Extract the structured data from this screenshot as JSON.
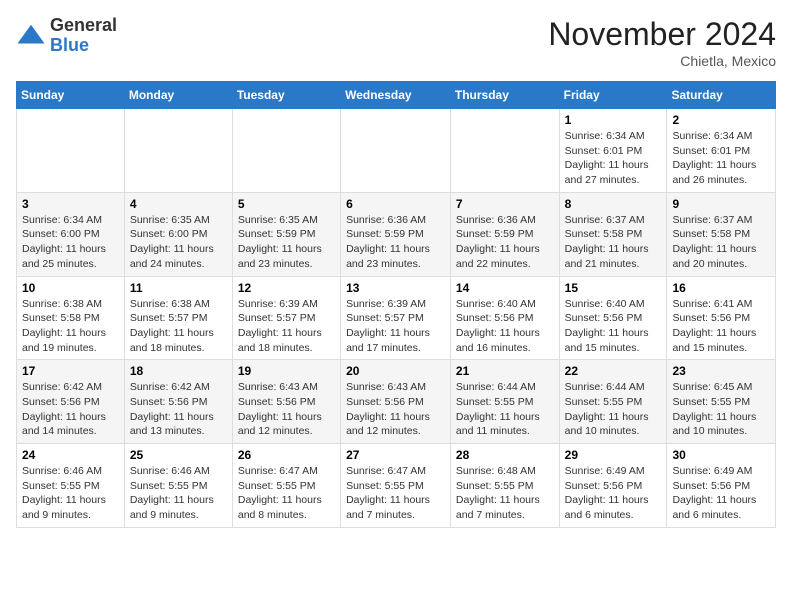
{
  "logo": {
    "general": "General",
    "blue": "Blue"
  },
  "header": {
    "month": "November 2024",
    "location": "Chietla, Mexico"
  },
  "weekdays": [
    "Sunday",
    "Monday",
    "Tuesday",
    "Wednesday",
    "Thursday",
    "Friday",
    "Saturday"
  ],
  "weeks": [
    [
      {
        "day": "",
        "info": ""
      },
      {
        "day": "",
        "info": ""
      },
      {
        "day": "",
        "info": ""
      },
      {
        "day": "",
        "info": ""
      },
      {
        "day": "",
        "info": ""
      },
      {
        "day": "1",
        "info": "Sunrise: 6:34 AM\nSunset: 6:01 PM\nDaylight: 11 hours\nand 27 minutes."
      },
      {
        "day": "2",
        "info": "Sunrise: 6:34 AM\nSunset: 6:01 PM\nDaylight: 11 hours\nand 26 minutes."
      }
    ],
    [
      {
        "day": "3",
        "info": "Sunrise: 6:34 AM\nSunset: 6:00 PM\nDaylight: 11 hours\nand 25 minutes."
      },
      {
        "day": "4",
        "info": "Sunrise: 6:35 AM\nSunset: 6:00 PM\nDaylight: 11 hours\nand 24 minutes."
      },
      {
        "day": "5",
        "info": "Sunrise: 6:35 AM\nSunset: 5:59 PM\nDaylight: 11 hours\nand 23 minutes."
      },
      {
        "day": "6",
        "info": "Sunrise: 6:36 AM\nSunset: 5:59 PM\nDaylight: 11 hours\nand 23 minutes."
      },
      {
        "day": "7",
        "info": "Sunrise: 6:36 AM\nSunset: 5:59 PM\nDaylight: 11 hours\nand 22 minutes."
      },
      {
        "day": "8",
        "info": "Sunrise: 6:37 AM\nSunset: 5:58 PM\nDaylight: 11 hours\nand 21 minutes."
      },
      {
        "day": "9",
        "info": "Sunrise: 6:37 AM\nSunset: 5:58 PM\nDaylight: 11 hours\nand 20 minutes."
      }
    ],
    [
      {
        "day": "10",
        "info": "Sunrise: 6:38 AM\nSunset: 5:58 PM\nDaylight: 11 hours\nand 19 minutes."
      },
      {
        "day": "11",
        "info": "Sunrise: 6:38 AM\nSunset: 5:57 PM\nDaylight: 11 hours\nand 18 minutes."
      },
      {
        "day": "12",
        "info": "Sunrise: 6:39 AM\nSunset: 5:57 PM\nDaylight: 11 hours\nand 18 minutes."
      },
      {
        "day": "13",
        "info": "Sunrise: 6:39 AM\nSunset: 5:57 PM\nDaylight: 11 hours\nand 17 minutes."
      },
      {
        "day": "14",
        "info": "Sunrise: 6:40 AM\nSunset: 5:56 PM\nDaylight: 11 hours\nand 16 minutes."
      },
      {
        "day": "15",
        "info": "Sunrise: 6:40 AM\nSunset: 5:56 PM\nDaylight: 11 hours\nand 15 minutes."
      },
      {
        "day": "16",
        "info": "Sunrise: 6:41 AM\nSunset: 5:56 PM\nDaylight: 11 hours\nand 15 minutes."
      }
    ],
    [
      {
        "day": "17",
        "info": "Sunrise: 6:42 AM\nSunset: 5:56 PM\nDaylight: 11 hours\nand 14 minutes."
      },
      {
        "day": "18",
        "info": "Sunrise: 6:42 AM\nSunset: 5:56 PM\nDaylight: 11 hours\nand 13 minutes."
      },
      {
        "day": "19",
        "info": "Sunrise: 6:43 AM\nSunset: 5:56 PM\nDaylight: 11 hours\nand 12 minutes."
      },
      {
        "day": "20",
        "info": "Sunrise: 6:43 AM\nSunset: 5:56 PM\nDaylight: 11 hours\nand 12 minutes."
      },
      {
        "day": "21",
        "info": "Sunrise: 6:44 AM\nSunset: 5:55 PM\nDaylight: 11 hours\nand 11 minutes."
      },
      {
        "day": "22",
        "info": "Sunrise: 6:44 AM\nSunset: 5:55 PM\nDaylight: 11 hours\nand 10 minutes."
      },
      {
        "day": "23",
        "info": "Sunrise: 6:45 AM\nSunset: 5:55 PM\nDaylight: 11 hours\nand 10 minutes."
      }
    ],
    [
      {
        "day": "24",
        "info": "Sunrise: 6:46 AM\nSunset: 5:55 PM\nDaylight: 11 hours\nand 9 minutes."
      },
      {
        "day": "25",
        "info": "Sunrise: 6:46 AM\nSunset: 5:55 PM\nDaylight: 11 hours\nand 9 minutes."
      },
      {
        "day": "26",
        "info": "Sunrise: 6:47 AM\nSunset: 5:55 PM\nDaylight: 11 hours\nand 8 minutes."
      },
      {
        "day": "27",
        "info": "Sunrise: 6:47 AM\nSunset: 5:55 PM\nDaylight: 11 hours\nand 7 minutes."
      },
      {
        "day": "28",
        "info": "Sunrise: 6:48 AM\nSunset: 5:55 PM\nDaylight: 11 hours\nand 7 minutes."
      },
      {
        "day": "29",
        "info": "Sunrise: 6:49 AM\nSunset: 5:56 PM\nDaylight: 11 hours\nand 6 minutes."
      },
      {
        "day": "30",
        "info": "Sunrise: 6:49 AM\nSunset: 5:56 PM\nDaylight: 11 hours\nand 6 minutes."
      }
    ]
  ]
}
